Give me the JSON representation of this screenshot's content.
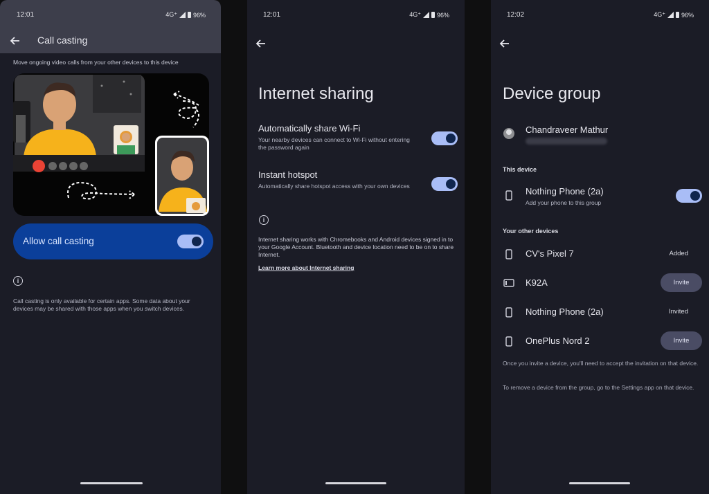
{
  "screen1": {
    "status": {
      "time": "12:01",
      "net": "4G⁺",
      "battery": "96%"
    },
    "title": "Call casting",
    "subtitle": "Move ongoing video calls from your other devices to this device",
    "toggle_label": "Allow call casting",
    "toggle_on": true,
    "info_text": "Call casting is only available for certain apps. Some data about your devices may be shared with those apps when you switch devices."
  },
  "screen2": {
    "status": {
      "time": "12:01",
      "net": "4G⁺",
      "battery": "96%"
    },
    "title": "Internet sharing",
    "settings": [
      {
        "label": "Automatically share Wi-Fi",
        "desc": "Your nearby devices can connect to Wi-Fi without entering the password again",
        "on": true
      },
      {
        "label": "Instant hotspot",
        "desc": "Automatically share hotspot access with your own devices",
        "on": true
      }
    ],
    "info_text": "Internet sharing works with Chromebooks and Android devices signed in to your Google Account. Bluetooth and device location need to be on to share Internet.",
    "link": "Learn more about Internet sharing"
  },
  "screen3": {
    "status": {
      "time": "12:02",
      "net": "4G⁺",
      "battery": "96%"
    },
    "title": "Device group",
    "account_name": "Chandraveer Mathur",
    "this_device_header": "This device",
    "this_device": {
      "name": "Nothing Phone (2a)",
      "desc": "Add your phone to this group",
      "on": true
    },
    "other_header": "Your other devices",
    "devices": [
      {
        "name": "CV's Pixel 7",
        "state": "Added",
        "type": "phone"
      },
      {
        "name": "K92A",
        "state": "Invite",
        "type": "tablet"
      },
      {
        "name": "Nothing Phone (2a)",
        "state": "Invited",
        "type": "phone"
      },
      {
        "name": "OnePlus Nord 2",
        "state": "Invite",
        "type": "phone"
      }
    ],
    "note1": "Once you invite a device, you'll need to accept the invitation on that device.",
    "note2": "To remove a device from the group, go to the Settings app on that device."
  },
  "colors": {
    "background": "#1b1c26",
    "toggle_track": "#a9bdf6",
    "accent_card": "#0b3f9a",
    "invite_button": "#4a4c64"
  }
}
